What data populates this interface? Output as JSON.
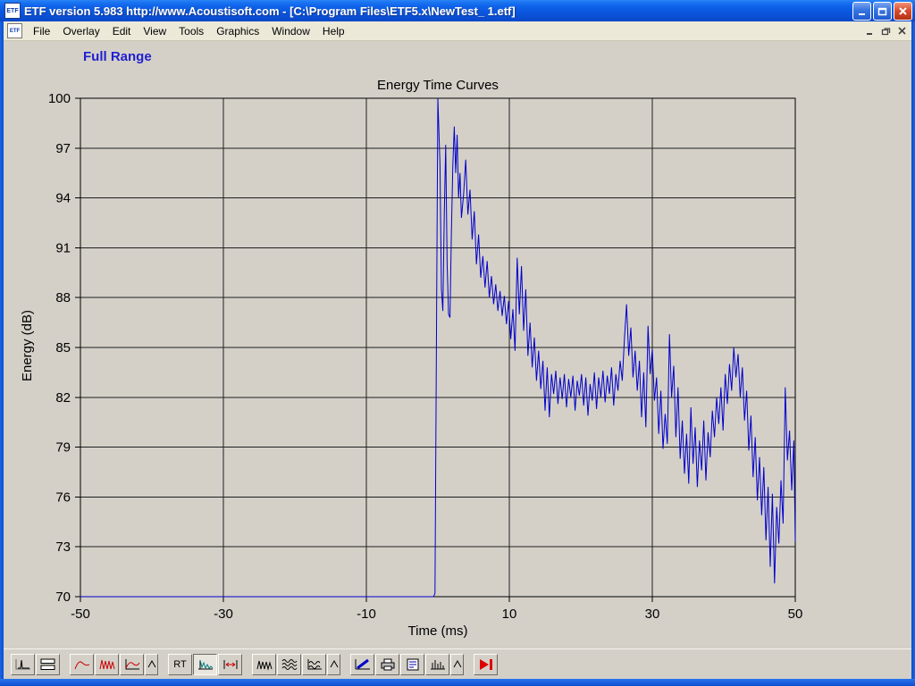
{
  "window": {
    "title": "ETF version 5.983 http://www.Acoustisoft.com - [C:\\Program Files\\ETF5.x\\NewTest_ 1.etf]",
    "icon_text": "ETF"
  },
  "menu": {
    "items": [
      "File",
      "Overlay",
      "Edit",
      "View",
      "Tools",
      "Graphics",
      "Window",
      "Help"
    ]
  },
  "chart": {
    "full_range_label": "Full Range",
    "title": "Energy Time Curves",
    "xlabel": "Time (ms)",
    "ylabel": "Energy (dB)"
  },
  "chart_data": {
    "type": "line",
    "title": "Energy Time Curves",
    "xlabel": "Time (ms)",
    "ylabel": "Energy (dB)",
    "xlim": [
      -50,
      50
    ],
    "ylim": [
      70,
      100
    ],
    "x_ticks": [
      -50,
      -30,
      -10,
      10,
      30,
      50
    ],
    "y_ticks": [
      100,
      97,
      94,
      91,
      88,
      85,
      82,
      79,
      76,
      73,
      70
    ],
    "grid": true,
    "legend": "none",
    "background": "#d4d0c8",
    "series": [
      {
        "name": "Full Range",
        "color": "#0000cc",
        "points": [
          [
            -50,
            70
          ],
          [
            -0.6,
            70
          ],
          [
            -0.4,
            70.2
          ],
          [
            0,
            100
          ],
          [
            0.3,
            96
          ],
          [
            0.5,
            88.5
          ],
          [
            0.7,
            87.2
          ],
          [
            0.9,
            93
          ],
          [
            1.1,
            97.2
          ],
          [
            1.3,
            90
          ],
          [
            1.5,
            87
          ],
          [
            1.7,
            86.8
          ],
          [
            1.9,
            92
          ],
          [
            2.1,
            96
          ],
          [
            2.3,
            98.3
          ],
          [
            2.5,
            95.5
          ],
          [
            2.7,
            97.8
          ],
          [
            2.9,
            94
          ],
          [
            3.1,
            95.5
          ],
          [
            3.3,
            92.8
          ],
          [
            3.6,
            94.2
          ],
          [
            3.9,
            96.3
          ],
          [
            4.2,
            93
          ],
          [
            4.5,
            94.5
          ],
          [
            4.8,
            91.5
          ],
          [
            5.1,
            93.2
          ],
          [
            5.4,
            90
          ],
          [
            5.7,
            91.8
          ],
          [
            6.0,
            89.2
          ],
          [
            6.3,
            90.5
          ],
          [
            6.6,
            88.6
          ],
          [
            6.9,
            90.2
          ],
          [
            7.2,
            88
          ],
          [
            7.5,
            89.3
          ],
          [
            7.8,
            87.6
          ],
          [
            8.1,
            88.8
          ],
          [
            8.4,
            87.2
          ],
          [
            8.7,
            88.4
          ],
          [
            9.0,
            86.9
          ],
          [
            9.3,
            88.1
          ],
          [
            9.6,
            86.4
          ],
          [
            9.9,
            87.8
          ],
          [
            10.2,
            85.5
          ],
          [
            10.5,
            87.3
          ],
          [
            10.8,
            84.8
          ],
          [
            11.1,
            90.4
          ],
          [
            11.4,
            87
          ],
          [
            11.7,
            89.9
          ],
          [
            12.0,
            86
          ],
          [
            12.3,
            88.5
          ],
          [
            12.6,
            84.5
          ],
          [
            12.9,
            86.5
          ],
          [
            13.2,
            83.8
          ],
          [
            13.5,
            85.6
          ],
          [
            13.8,
            83
          ],
          [
            14.1,
            84.8
          ],
          [
            14.4,
            82.5
          ],
          [
            14.7,
            84.2
          ],
          [
            15.0,
            81.2
          ],
          [
            15.3,
            83.8
          ],
          [
            15.6,
            80.8
          ],
          [
            15.9,
            83.4
          ],
          [
            16.2,
            82.2
          ],
          [
            16.5,
            83.6
          ],
          [
            16.8,
            81.6
          ],
          [
            17.1,
            83.2
          ],
          [
            17.4,
            81.9
          ],
          [
            17.7,
            83.4
          ],
          [
            18.0,
            81.4
          ],
          [
            18.3,
            83.1
          ],
          [
            18.6,
            82
          ],
          [
            18.9,
            83.3
          ],
          [
            19.2,
            81.2
          ],
          [
            19.5,
            83
          ],
          [
            19.8,
            82.1
          ],
          [
            20.1,
            83.4
          ],
          [
            20.4,
            81.5
          ],
          [
            20.7,
            83.2
          ],
          [
            21.0,
            80.9
          ],
          [
            21.3,
            82.8
          ],
          [
            21.6,
            81.8
          ],
          [
            21.9,
            83.5
          ],
          [
            22.2,
            81.3
          ],
          [
            22.5,
            83.2
          ],
          [
            22.8,
            82
          ],
          [
            23.1,
            83.6
          ],
          [
            23.4,
            81.7
          ],
          [
            23.7,
            83.3
          ],
          [
            24.0,
            82.2
          ],
          [
            24.3,
            83.8
          ],
          [
            24.6,
            81.5
          ],
          [
            24.9,
            83.4
          ],
          [
            25.2,
            82.4
          ],
          [
            25.5,
            84.2
          ],
          [
            25.8,
            83
          ],
          [
            26.1,
            85.5
          ],
          [
            26.4,
            87.6
          ],
          [
            26.7,
            84.5
          ],
          [
            27.0,
            86.2
          ],
          [
            27.3,
            83.2
          ],
          [
            27.6,
            84.8
          ],
          [
            27.9,
            82.4
          ],
          [
            28.2,
            84.2
          ],
          [
            28.5,
            80.8
          ],
          [
            28.8,
            83.5
          ],
          [
            29.1,
            80.2
          ],
          [
            29.4,
            86.3
          ],
          [
            29.7,
            83.4
          ],
          [
            30.0,
            84.9
          ],
          [
            30.3,
            81.8
          ],
          [
            30.6,
            83.2
          ],
          [
            30.9,
            79.8
          ],
          [
            31.2,
            82.4
          ],
          [
            31.5,
            78.9
          ],
          [
            31.8,
            81
          ],
          [
            32.1,
            79.2
          ],
          [
            32.4,
            85.8
          ],
          [
            32.7,
            82
          ],
          [
            33.0,
            83.9
          ],
          [
            33.3,
            79.6
          ],
          [
            33.6,
            82.6
          ],
          [
            33.9,
            78.3
          ],
          [
            34.2,
            80.6
          ],
          [
            34.5,
            77.4
          ],
          [
            34.8,
            79.8
          ],
          [
            35.1,
            76.8
          ],
          [
            35.4,
            81.4
          ],
          [
            35.7,
            78
          ],
          [
            36.0,
            80.2
          ],
          [
            36.3,
            76.6
          ],
          [
            36.6,
            79.4
          ],
          [
            36.9,
            77.6
          ],
          [
            37.2,
            80.6
          ],
          [
            37.5,
            77
          ],
          [
            37.8,
            79.9
          ],
          [
            38.1,
            78.4
          ],
          [
            38.4,
            81.2
          ],
          [
            38.7,
            79.6
          ],
          [
            39.0,
            82
          ],
          [
            39.3,
            80.4
          ],
          [
            39.6,
            82.6
          ],
          [
            39.9,
            80
          ],
          [
            40.2,
            83.4
          ],
          [
            40.5,
            81.6
          ],
          [
            40.8,
            84
          ],
          [
            41.1,
            82.4
          ],
          [
            41.4,
            85
          ],
          [
            41.7,
            83.2
          ],
          [
            42.0,
            84.6
          ],
          [
            42.3,
            82
          ],
          [
            42.6,
            83.8
          ],
          [
            42.9,
            80.6
          ],
          [
            43.2,
            82.4
          ],
          [
            43.5,
            78.8
          ],
          [
            43.8,
            80.9
          ],
          [
            44.1,
            77.2
          ],
          [
            44.4,
            79.6
          ],
          [
            44.7,
            75.8
          ],
          [
            45.0,
            78.4
          ],
          [
            45.3,
            74.9
          ],
          [
            45.6,
            77.8
          ],
          [
            45.9,
            73.4
          ],
          [
            46.2,
            76.6
          ],
          [
            46.5,
            71.8
          ],
          [
            46.8,
            76.2
          ],
          [
            47.1,
            70.8
          ],
          [
            47.4,
            75.4
          ],
          [
            47.7,
            73.2
          ],
          [
            48.0,
            77
          ],
          [
            48.3,
            74.4
          ],
          [
            48.6,
            82.6
          ],
          [
            48.9,
            78.2
          ],
          [
            49.2,
            80
          ],
          [
            49.5,
            76.4
          ],
          [
            49.8,
            79.4
          ],
          [
            50,
            73.3
          ]
        ]
      }
    ]
  },
  "toolbar": {
    "rt_label": "RT",
    "buttons": [
      "impulse-response",
      "time-windows",
      "frequency-response",
      "harmonic-distortion",
      "overlay-curves",
      "overlay-options",
      "reverb-time",
      "energy-time-curve",
      "gating",
      "waveform",
      "waterfall",
      "waterfall-options",
      "slope",
      "print",
      "notes",
      "spl-meter",
      "spl-options",
      "play"
    ],
    "icons": {
      "impulse-response": "spike-on-axis",
      "time-windows": "two-rectangles",
      "frequency-response": "red-curve",
      "harmonic-distortion": "red-zigzag",
      "overlay-curves": "red-curve-on-axis",
      "reverb-time": "RT-text",
      "energy-time-curve": "teal-decay-curve",
      "gating": "arrows-between-bars",
      "waveform": "black-zigzag",
      "waterfall": "stacked-waves",
      "waterfall-options": "stacked-waves-on-axis",
      "slope": "blue-diagonal-line",
      "print": "printer",
      "notes": "document-lines",
      "spl-meter": "vertical-bars",
      "play": "red-play-arrow"
    }
  },
  "colors": {
    "titlebar_blue": "#0a55dd",
    "window_gray": "#d4d0c8",
    "curve_blue": "#0000cc",
    "full_range_blue": "#2020d0",
    "close_red": "#d6492a"
  }
}
